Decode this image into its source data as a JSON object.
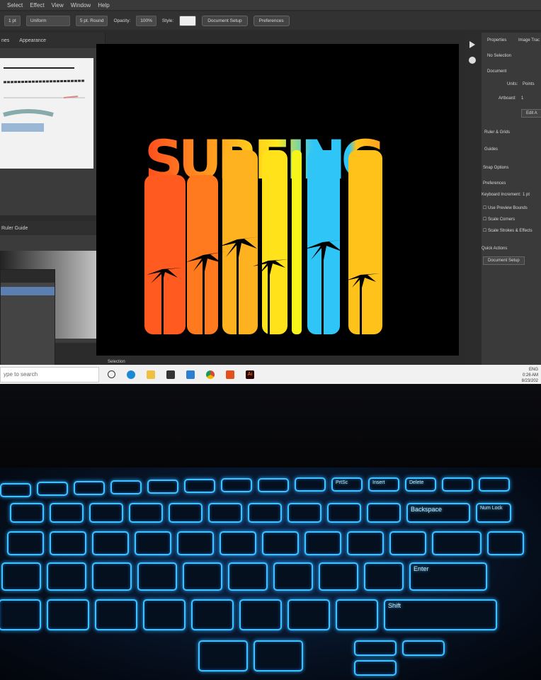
{
  "menu": [
    "Select",
    "Effect",
    "View",
    "Window",
    "Help"
  ],
  "toolbar": {
    "stroke_weight": "1 pt",
    "stroke_profile": "Uniform",
    "brush": "5 pt. Round",
    "opacity_label": "Opacity:",
    "opacity_value": "100%",
    "style_label": "Style:",
    "document_setup": "Document Setup",
    "preferences": "Preferences"
  },
  "left_panel": {
    "tab1": "nes",
    "tab2": "Appearance",
    "title2": "Ruler Guide"
  },
  "artwork": {
    "text": "SURFING",
    "colors": [
      "#ff5a1f",
      "#ff7a1f",
      "#ffb21f",
      "#ffe21a",
      "#f5f51a",
      "#2fc6f7",
      "#ffc21a"
    ]
  },
  "properties": {
    "tab_properties": "Properties",
    "tab_image": "Image Trac",
    "no_selection": "No Selection",
    "document": "Document",
    "units_label": "Units:",
    "units_value": "Points",
    "artboard_label": "Artboard:",
    "artboard_value": "1",
    "edit_button": "Edit A",
    "ruler_grid": "Ruler & Grids",
    "guides": "Guides",
    "snap_options": "Snap Options",
    "preferences": "Preferences",
    "keyboard_increment": "Keyboard Increment:",
    "keyboard_value": "1 pt",
    "use_preview_bounds": "Use Preview Bounds",
    "scale_corners": "Scale Corners",
    "scale_strokes": "Scale Strokes & Effects",
    "quick_actions": "Quick Actions",
    "doc_setup_button": "Document Setup"
  },
  "status": {
    "tool": "Selection"
  },
  "taskbar": {
    "search": "ype to search",
    "time": "0:26 AM",
    "date": "8/23/202",
    "lang": "ENG"
  },
  "keys": {
    "backspace": "Backspace",
    "numlock": "Num Lock",
    "enter": "Enter",
    "shift": "Shift",
    "prtsc": "PrtSc",
    "insert": "Insert",
    "delete": "Delete"
  }
}
